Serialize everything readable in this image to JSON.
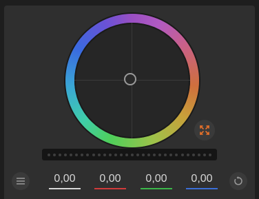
{
  "wheel": {
    "center_icon": "circle-puck-icon"
  },
  "expand": {
    "icon": "expand-arrows-icon",
    "color": "#e8712a"
  },
  "slider": {
    "dots": 30
  },
  "values": [
    {
      "channel": "master",
      "value": "0,00",
      "color": "#d8d8d8"
    },
    {
      "channel": "red",
      "value": "0,00",
      "color": "#d23b3b"
    },
    {
      "channel": "green",
      "value": "0,00",
      "color": "#3bb84a"
    },
    {
      "channel": "blue",
      "value": "0,00",
      "color": "#3b6fd8"
    }
  ],
  "menu": {
    "icon": "hamburger-menu-icon"
  },
  "reset": {
    "icon": "reset-icon"
  }
}
